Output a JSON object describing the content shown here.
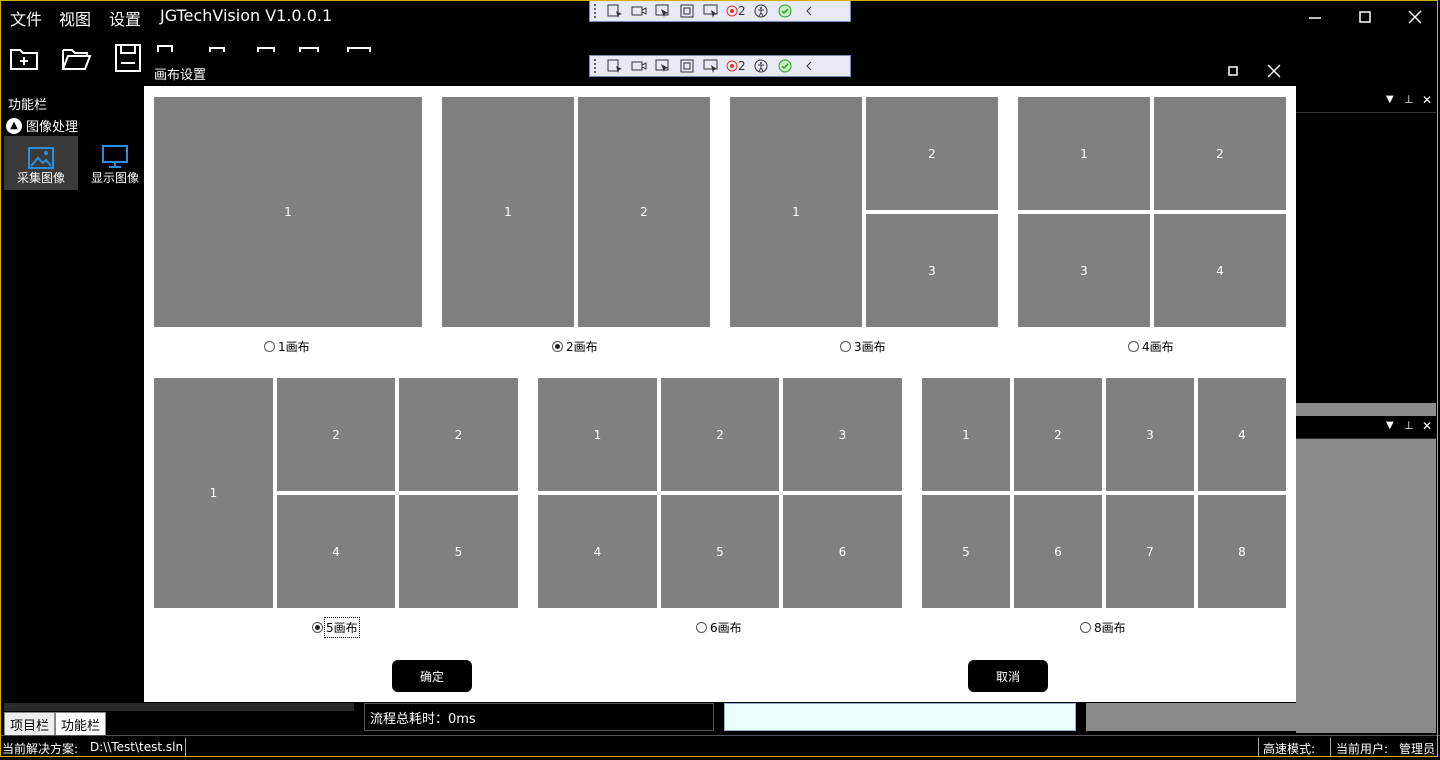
{
  "menu": {
    "file": "文件",
    "view": "视图",
    "settings": "设置",
    "app_title": "JGTechVision V1.0.0.1"
  },
  "floating_toolbar": {
    "count": "2"
  },
  "sidebar": {
    "title": "功能栏",
    "group": "图像处理",
    "tools": [
      "采集图像",
      "显示图像"
    ]
  },
  "bottom_tabs": [
    "项目栏",
    "功能栏"
  ],
  "flow_time": "流程总耗时：0ms",
  "status": {
    "solution_label": "当前解决方案:",
    "solution_path": "D:\\\\Test\\test.sln",
    "speed_label": "高速模式:",
    "user_label": "当前用户:",
    "user_value": "管理员"
  },
  "dialog": {
    "title": "画布设置",
    "options": [
      "1画布",
      "2画布",
      "3画布",
      "4画布",
      "5画布",
      "6画布",
      "8画布"
    ],
    "selected_top": "2画布",
    "selected_bottom": "5画布",
    "ok_label": "确定",
    "cancel_label": "取消",
    "layout1": [
      "1"
    ],
    "layout2": [
      "1",
      "2"
    ],
    "layout3": [
      "1",
      "2",
      "3"
    ],
    "layout4": [
      "1",
      "2",
      "3",
      "4"
    ],
    "layout5": [
      "1",
      "2",
      "2",
      "4",
      "5"
    ],
    "layout6": [
      "1",
      "2",
      "3",
      "4",
      "5",
      "6"
    ],
    "layout8": [
      "1",
      "2",
      "3",
      "4",
      "5",
      "6",
      "7",
      "8"
    ]
  },
  "colors": {
    "canvas_cell": "#808080",
    "dialog_bg": "#ffffff",
    "frame": "#d4b000",
    "cyan_panel": "#ebffff"
  }
}
